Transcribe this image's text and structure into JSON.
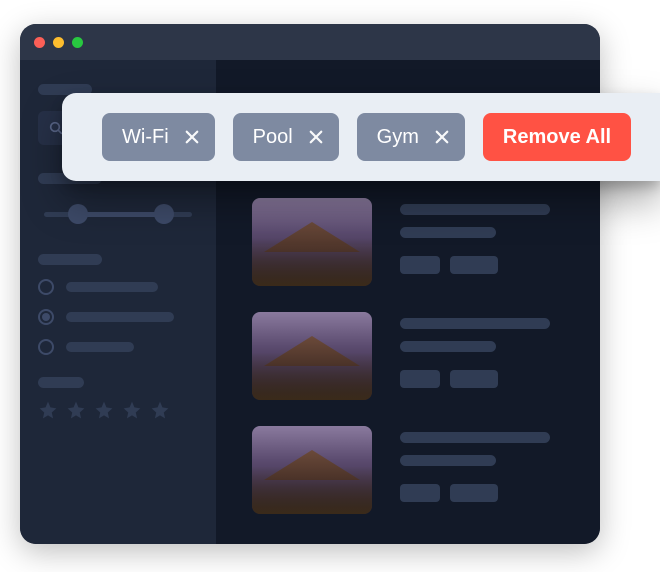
{
  "filters": {
    "chips": [
      {
        "label": "Wi-Fi"
      },
      {
        "label": "Pool"
      },
      {
        "label": "Gym"
      }
    ],
    "remove_all_label": "Remove All"
  },
  "colors": {
    "accent": "#ff5244",
    "chip_bg": "#7e8aa1",
    "window_bg": "#1b2232"
  },
  "sidebar": {
    "radio_selected_index": 1,
    "star_count": 5
  }
}
